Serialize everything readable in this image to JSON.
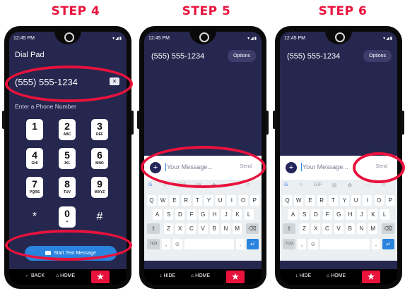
{
  "steps": [
    {
      "title": "STEP 4",
      "status_time": "12:45 PM",
      "screen_title": "Dial Pad",
      "phone_number": "(555) 555-1234",
      "hint": "Enter a Phone Number",
      "keys": [
        {
          "digit": "1",
          "letters": ""
        },
        {
          "digit": "2",
          "letters": "ABC"
        },
        {
          "digit": "3",
          "letters": "DEF"
        },
        {
          "digit": "4",
          "letters": "GHI"
        },
        {
          "digit": "5",
          "letters": "JKL"
        },
        {
          "digit": "6",
          "letters": "MNO"
        },
        {
          "digit": "7",
          "letters": "PQRS"
        },
        {
          "digit": "8",
          "letters": "TUV"
        },
        {
          "digit": "9",
          "letters": "WXYZ"
        },
        {
          "digit": "*",
          "letters": ""
        },
        {
          "digit": "0",
          "letters": "+"
        },
        {
          "digit": "#",
          "letters": ""
        }
      ],
      "start_button": "Start Text Message",
      "nav_back": "← BACK",
      "nav_home": "⌂ HOME"
    },
    {
      "title": "STEP 5",
      "status_time": "12:45 PM",
      "contact": "(555) 555-1234",
      "options": "Options",
      "message_placeholder": "Your Message...",
      "send": "Send",
      "nav_hide": "↓ HIDE",
      "nav_home": "⌂ HOME"
    },
    {
      "title": "STEP 6",
      "status_time": "12:45 PM",
      "contact": "(555) 555-1234",
      "options": "Options",
      "message_placeholder": "Your Message...",
      "send": "Send",
      "nav_hide": "↓ HIDE",
      "nav_home": "⌂ HOME"
    }
  ],
  "keyboard": {
    "row1": [
      "Q",
      "W",
      "E",
      "R",
      "T",
      "Y",
      "U",
      "I",
      "O",
      "P"
    ],
    "row2": [
      "A",
      "S",
      "D",
      "F",
      "G",
      "H",
      "J",
      "K",
      "L"
    ],
    "row3": [
      "Z",
      "X",
      "C",
      "V",
      "B",
      "N",
      "M"
    ],
    "sym": "?123"
  },
  "colors": {
    "accent_red": "#e8123c",
    "screen_bg": "#26274f",
    "button_blue": "#2a84de"
  }
}
